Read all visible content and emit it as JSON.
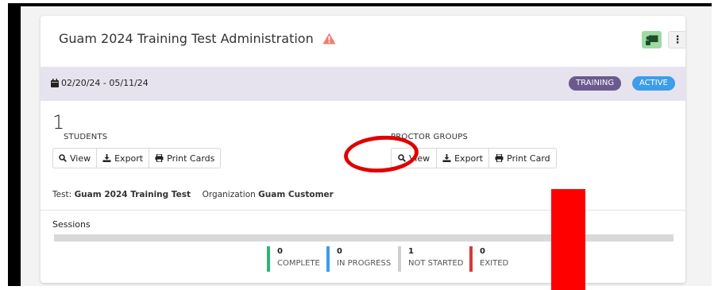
{
  "header": {
    "title": "Guam 2024 Training Test Administration",
    "warning_icon": "warning-triangle-icon",
    "person_icon": "person-chalkboard-icon",
    "more_icon": "vertical-ellipsis-icon",
    "more_label": "⋮"
  },
  "band": {
    "date_range": "02/20/24 - 05/11/24",
    "calendar_icon": "calendar-icon",
    "badges": {
      "training": "TRAINING",
      "active": "ACTIVE"
    }
  },
  "students": {
    "count": "1",
    "label": "STUDENTS",
    "buttons": {
      "view": "View",
      "export": "Export",
      "print": "Print Cards"
    }
  },
  "proctor_groups": {
    "label": "PROCTOR GROUPS",
    "buttons": {
      "view": "View",
      "export": "Export",
      "print": "Print Card"
    }
  },
  "meta": {
    "test_label": "Test:",
    "test_value": "Guam 2024 Training Test",
    "org_label": "Organization",
    "org_value": "Guam Customer"
  },
  "sessions": {
    "label": "Sessions",
    "stats": [
      {
        "value": "0",
        "label": "COMPLETE",
        "color": "#2bb673"
      },
      {
        "value": "0",
        "label": "IN PROGRESS",
        "color": "#3c9dea"
      },
      {
        "value": "1",
        "label": "NOT STARTED",
        "color": "#cfcfcf"
      },
      {
        "value": "0",
        "label": "EXITED",
        "color": "#d9383a"
      }
    ]
  },
  "colors": {
    "annotation_red": "#e10000",
    "band_bg": "#e6e3ef",
    "training_badge": "#6a5a8e",
    "active_badge": "#3c9dea"
  }
}
